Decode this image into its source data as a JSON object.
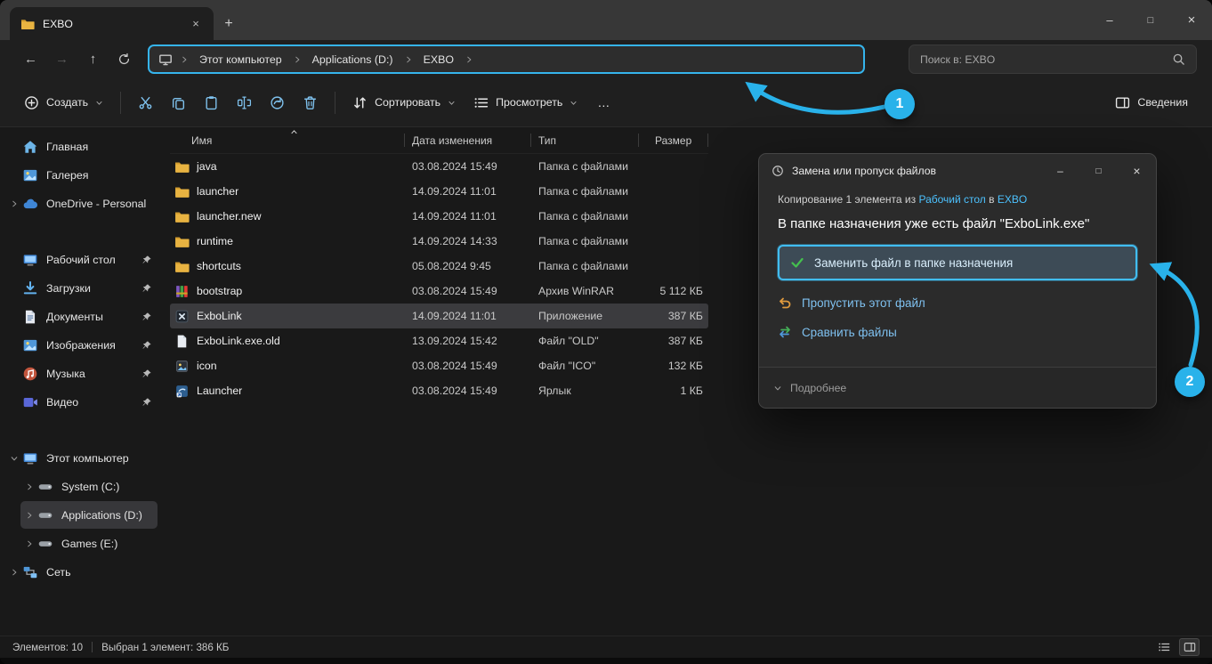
{
  "colors": {
    "accent": "#29b2ea",
    "link": "#4cc2ff",
    "highlight_border": "#35b4ec"
  },
  "glyphs": {
    "back": "←",
    "forward": "→",
    "up": "↑",
    "minimize": "–",
    "maximize": "□",
    "close": "×",
    "tab_close": "×",
    "new_tab": "+",
    "more": "…"
  },
  "titlebar": {
    "tab_title": "EXBO"
  },
  "navbar": {
    "breadcrumb": [
      "Этот компьютер",
      "Applications (D:)",
      "EXBO"
    ],
    "search_text": "Поиск в: EXBO"
  },
  "toolbar": {
    "new": "Создать",
    "sort": "Сортировать",
    "view": "Просмотреть",
    "details": "Сведения"
  },
  "sidebar": {
    "home": "Главная",
    "gallery": "Галерея",
    "onedrive": "OneDrive - Personal",
    "pinned": [
      {
        "label": "Рабочий стол"
      },
      {
        "label": "Загрузки"
      },
      {
        "label": "Документы"
      },
      {
        "label": "Изображения"
      },
      {
        "label": "Музыка"
      },
      {
        "label": "Видео"
      }
    ],
    "this_pc": "Этот компьютер",
    "drives": [
      {
        "label": "System (C:)"
      },
      {
        "label": "Applications (D:)"
      },
      {
        "label": "Games (E:)"
      }
    ],
    "network": "Сеть"
  },
  "filelist": {
    "columns": {
      "name": "Имя",
      "date": "Дата изменения",
      "type": "Тип",
      "size": "Размер"
    },
    "rows": [
      {
        "name": "java",
        "date": "03.08.2024 15:49",
        "type": "Папка с файлами",
        "size": ""
      },
      {
        "name": "launcher",
        "date": "14.09.2024 11:01",
        "type": "Папка с файлами",
        "size": ""
      },
      {
        "name": "launcher.new",
        "date": "14.09.2024 11:01",
        "type": "Папка с файлами",
        "size": ""
      },
      {
        "name": "runtime",
        "date": "14.09.2024 14:33",
        "type": "Папка с файлами",
        "size": ""
      },
      {
        "name": "shortcuts",
        "date": "05.08.2024 9:45",
        "type": "Папка с файлами",
        "size": ""
      },
      {
        "name": "bootstrap",
        "date": "03.08.2024 15:49",
        "type": "Архив WinRAR",
        "size": "5 112 КБ"
      },
      {
        "name": "ExboLink",
        "date": "14.09.2024 11:01",
        "type": "Приложение",
        "size": "387 КБ"
      },
      {
        "name": "ExboLink.exe.old",
        "date": "13.09.2024 15:42",
        "type": "Файл \"OLD\"",
        "size": "387 КБ"
      },
      {
        "name": "icon",
        "date": "03.08.2024 15:49",
        "type": "Файл \"ICO\"",
        "size": "132 КБ"
      },
      {
        "name": "Launcher",
        "date": "03.08.2024 15:49",
        "type": "Ярлык",
        "size": "1 КБ"
      }
    ]
  },
  "dialog": {
    "title": "Замена или пропуск файлов",
    "copy_prefix": "Копирование 1 элемента из ",
    "copy_from": "Рабочий стол",
    "copy_mid": " в ",
    "copy_to": "EXBO",
    "conflict": "В папке назначения уже есть файл \"ExboLink.exe\"",
    "replace": "Заменить файл в папке назначения",
    "skip": "Пропустить этот файл",
    "compare": "Сравнить файлы",
    "more": "Подробнее"
  },
  "statusbar": {
    "count": "Элементов: 10",
    "selection": "Выбран 1 элемент: 386 КБ"
  },
  "annotations": {
    "step1": "1",
    "step2": "2"
  }
}
